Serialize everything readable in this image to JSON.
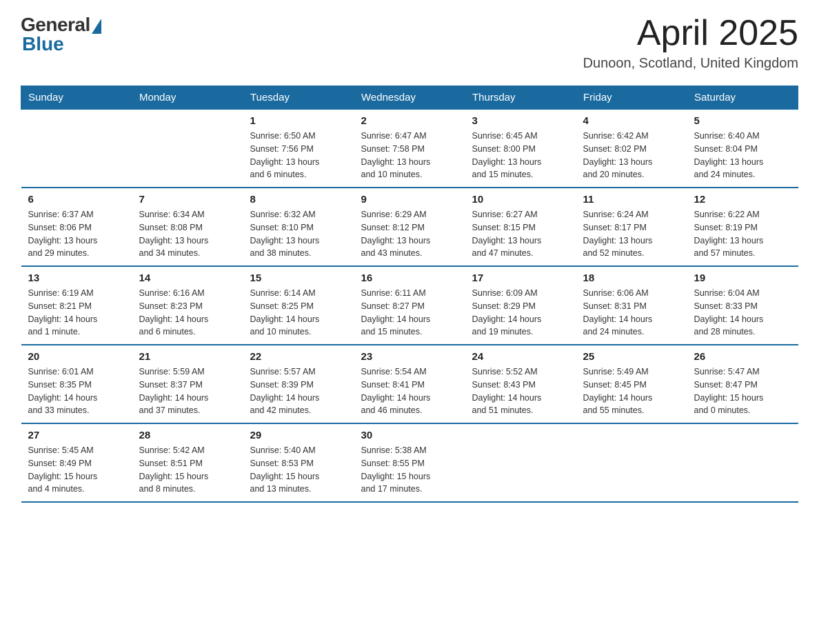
{
  "logo": {
    "general": "General",
    "blue": "Blue"
  },
  "title": "April 2025",
  "location": "Dunoon, Scotland, United Kingdom",
  "weekdays": [
    "Sunday",
    "Monday",
    "Tuesday",
    "Wednesday",
    "Thursday",
    "Friday",
    "Saturday"
  ],
  "weeks": [
    [
      {
        "day": "",
        "info": ""
      },
      {
        "day": "",
        "info": ""
      },
      {
        "day": "1",
        "info": "Sunrise: 6:50 AM\nSunset: 7:56 PM\nDaylight: 13 hours\nand 6 minutes."
      },
      {
        "day": "2",
        "info": "Sunrise: 6:47 AM\nSunset: 7:58 PM\nDaylight: 13 hours\nand 10 minutes."
      },
      {
        "day": "3",
        "info": "Sunrise: 6:45 AM\nSunset: 8:00 PM\nDaylight: 13 hours\nand 15 minutes."
      },
      {
        "day": "4",
        "info": "Sunrise: 6:42 AM\nSunset: 8:02 PM\nDaylight: 13 hours\nand 20 minutes."
      },
      {
        "day": "5",
        "info": "Sunrise: 6:40 AM\nSunset: 8:04 PM\nDaylight: 13 hours\nand 24 minutes."
      }
    ],
    [
      {
        "day": "6",
        "info": "Sunrise: 6:37 AM\nSunset: 8:06 PM\nDaylight: 13 hours\nand 29 minutes."
      },
      {
        "day": "7",
        "info": "Sunrise: 6:34 AM\nSunset: 8:08 PM\nDaylight: 13 hours\nand 34 minutes."
      },
      {
        "day": "8",
        "info": "Sunrise: 6:32 AM\nSunset: 8:10 PM\nDaylight: 13 hours\nand 38 minutes."
      },
      {
        "day": "9",
        "info": "Sunrise: 6:29 AM\nSunset: 8:12 PM\nDaylight: 13 hours\nand 43 minutes."
      },
      {
        "day": "10",
        "info": "Sunrise: 6:27 AM\nSunset: 8:15 PM\nDaylight: 13 hours\nand 47 minutes."
      },
      {
        "day": "11",
        "info": "Sunrise: 6:24 AM\nSunset: 8:17 PM\nDaylight: 13 hours\nand 52 minutes."
      },
      {
        "day": "12",
        "info": "Sunrise: 6:22 AM\nSunset: 8:19 PM\nDaylight: 13 hours\nand 57 minutes."
      }
    ],
    [
      {
        "day": "13",
        "info": "Sunrise: 6:19 AM\nSunset: 8:21 PM\nDaylight: 14 hours\nand 1 minute."
      },
      {
        "day": "14",
        "info": "Sunrise: 6:16 AM\nSunset: 8:23 PM\nDaylight: 14 hours\nand 6 minutes."
      },
      {
        "day": "15",
        "info": "Sunrise: 6:14 AM\nSunset: 8:25 PM\nDaylight: 14 hours\nand 10 minutes."
      },
      {
        "day": "16",
        "info": "Sunrise: 6:11 AM\nSunset: 8:27 PM\nDaylight: 14 hours\nand 15 minutes."
      },
      {
        "day": "17",
        "info": "Sunrise: 6:09 AM\nSunset: 8:29 PM\nDaylight: 14 hours\nand 19 minutes."
      },
      {
        "day": "18",
        "info": "Sunrise: 6:06 AM\nSunset: 8:31 PM\nDaylight: 14 hours\nand 24 minutes."
      },
      {
        "day": "19",
        "info": "Sunrise: 6:04 AM\nSunset: 8:33 PM\nDaylight: 14 hours\nand 28 minutes."
      }
    ],
    [
      {
        "day": "20",
        "info": "Sunrise: 6:01 AM\nSunset: 8:35 PM\nDaylight: 14 hours\nand 33 minutes."
      },
      {
        "day": "21",
        "info": "Sunrise: 5:59 AM\nSunset: 8:37 PM\nDaylight: 14 hours\nand 37 minutes."
      },
      {
        "day": "22",
        "info": "Sunrise: 5:57 AM\nSunset: 8:39 PM\nDaylight: 14 hours\nand 42 minutes."
      },
      {
        "day": "23",
        "info": "Sunrise: 5:54 AM\nSunset: 8:41 PM\nDaylight: 14 hours\nand 46 minutes."
      },
      {
        "day": "24",
        "info": "Sunrise: 5:52 AM\nSunset: 8:43 PM\nDaylight: 14 hours\nand 51 minutes."
      },
      {
        "day": "25",
        "info": "Sunrise: 5:49 AM\nSunset: 8:45 PM\nDaylight: 14 hours\nand 55 minutes."
      },
      {
        "day": "26",
        "info": "Sunrise: 5:47 AM\nSunset: 8:47 PM\nDaylight: 15 hours\nand 0 minutes."
      }
    ],
    [
      {
        "day": "27",
        "info": "Sunrise: 5:45 AM\nSunset: 8:49 PM\nDaylight: 15 hours\nand 4 minutes."
      },
      {
        "day": "28",
        "info": "Sunrise: 5:42 AM\nSunset: 8:51 PM\nDaylight: 15 hours\nand 8 minutes."
      },
      {
        "day": "29",
        "info": "Sunrise: 5:40 AM\nSunset: 8:53 PM\nDaylight: 15 hours\nand 13 minutes."
      },
      {
        "day": "30",
        "info": "Sunrise: 5:38 AM\nSunset: 8:55 PM\nDaylight: 15 hours\nand 17 minutes."
      },
      {
        "day": "",
        "info": ""
      },
      {
        "day": "",
        "info": ""
      },
      {
        "day": "",
        "info": ""
      }
    ]
  ]
}
